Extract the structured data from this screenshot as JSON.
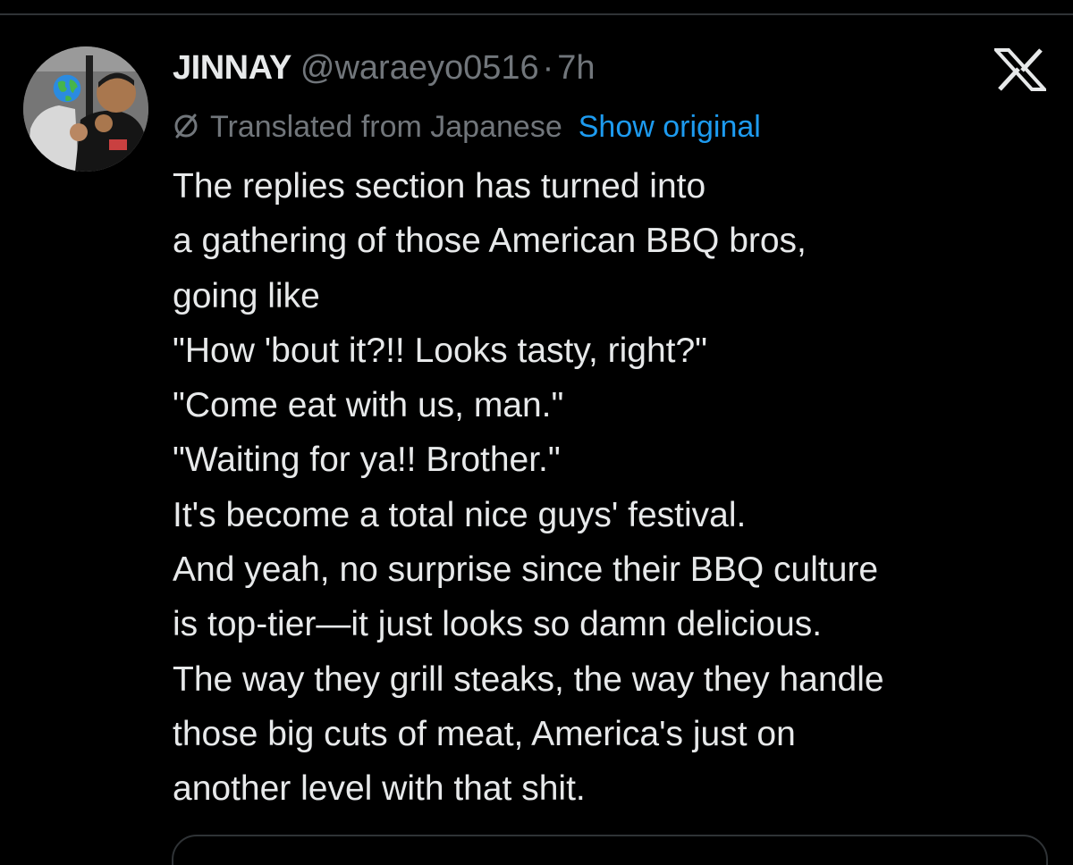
{
  "post": {
    "display_name": "JINNAY",
    "handle": "@waraeyo0516",
    "separator": "·",
    "timestamp": "7h",
    "translated_label": "Translated from Japanese",
    "show_original_label": "Show original",
    "text_lines": [
      "The replies section has turned into",
      "a gathering of those American BBQ bros,",
      "going like",
      "\"How 'bout it?!! Looks tasty, right?\"",
      "\"Come eat with us, man.\"",
      "\"Waiting for ya!! Brother.\"",
      "It's become a total nice guys' festival.",
      "And yeah, no surprise since their BBQ culture",
      "is top-tier—it just looks so damn delicious.",
      "The way they grill steaks, the way they handle",
      "those big cuts of meat, America's just on",
      "another level with that shit."
    ]
  },
  "icons": {
    "brand": "x-logo-icon",
    "translate": "translate-icon",
    "avatar_badge": "globe-emoji-icon"
  },
  "colors": {
    "background": "#000000",
    "primary_text": "#e7e9ea",
    "secondary_text": "#71767b",
    "link": "#1d9bf0",
    "divider": "#2f3336"
  }
}
